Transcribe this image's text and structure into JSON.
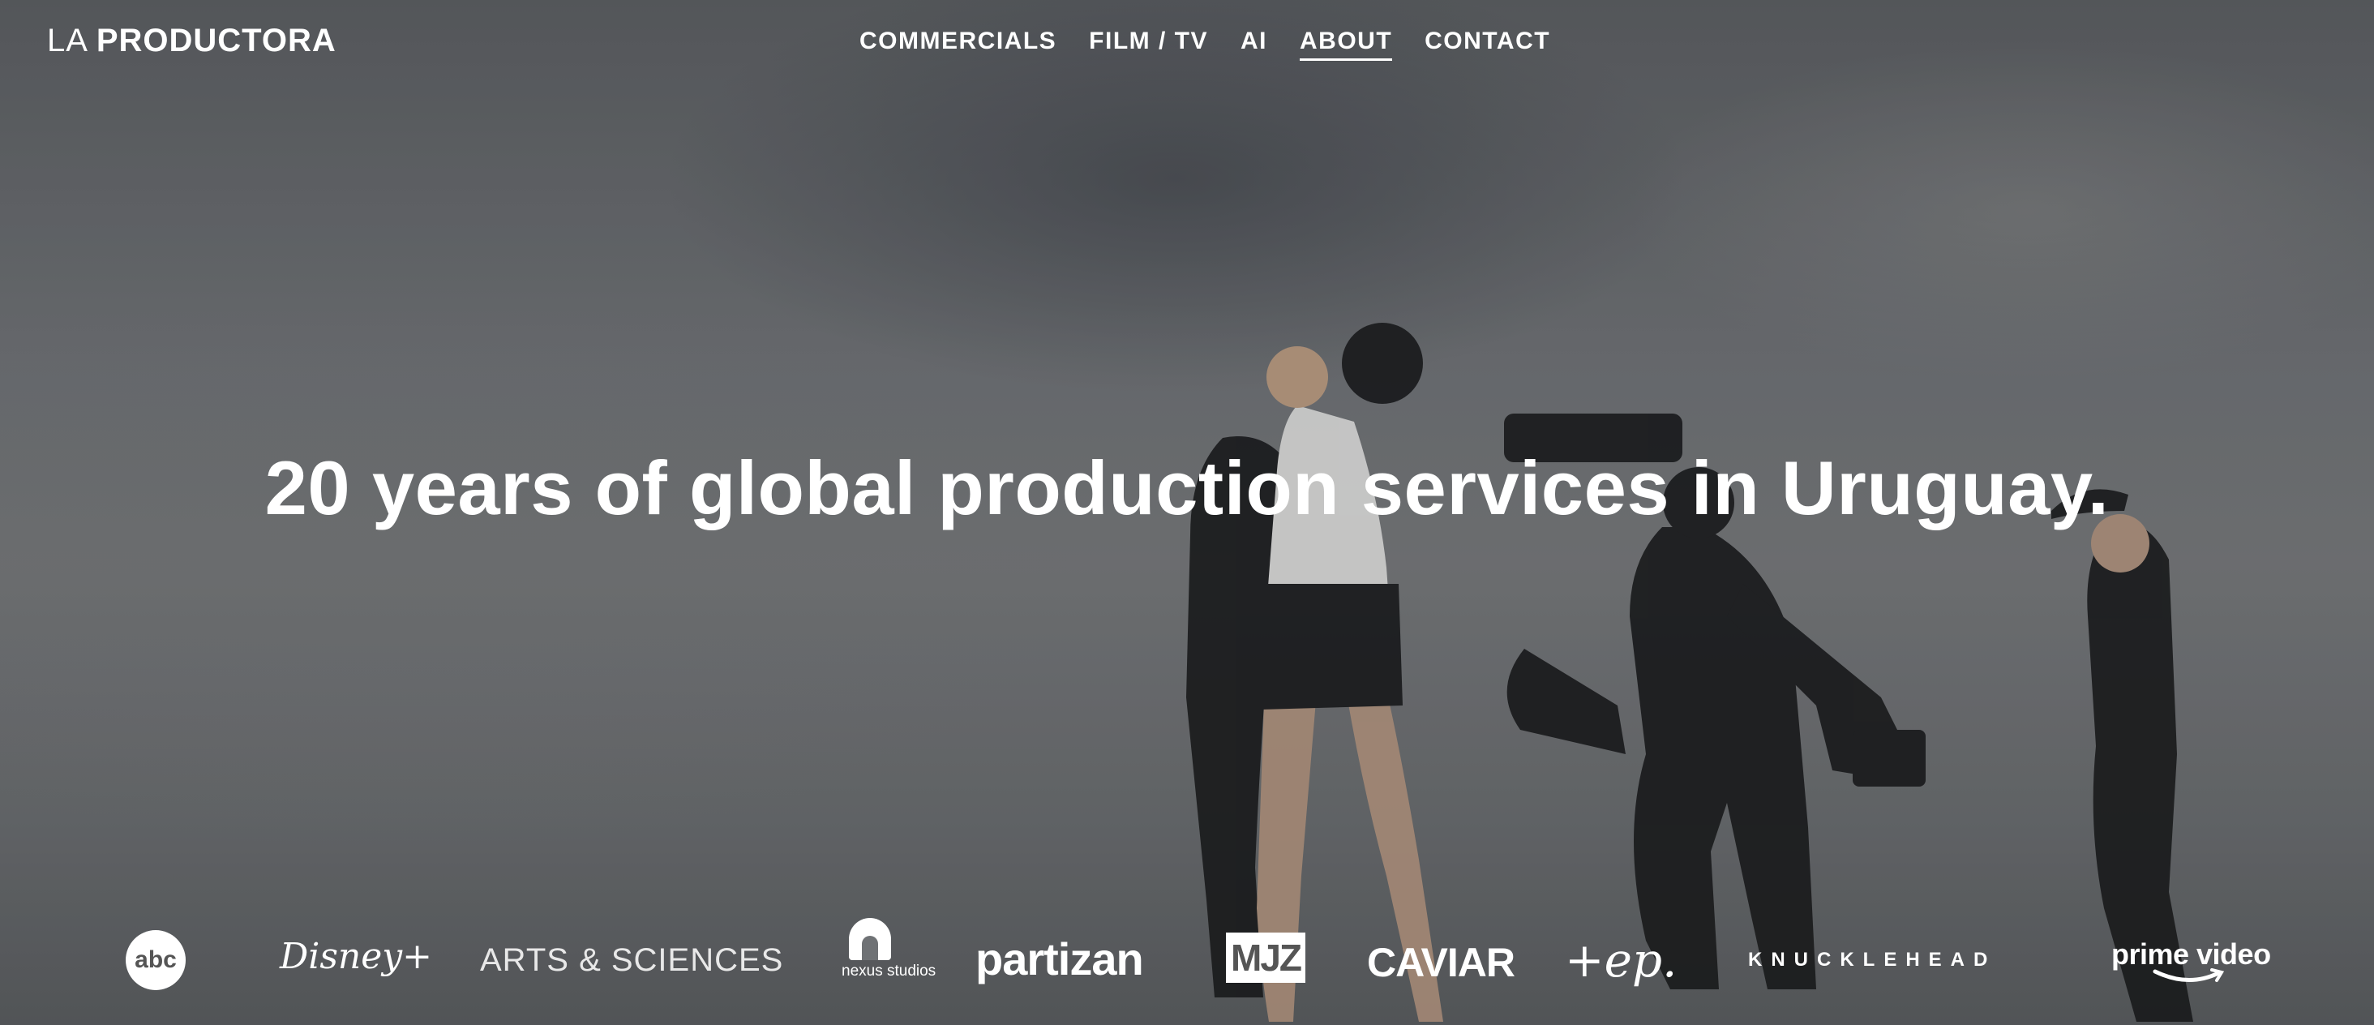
{
  "header": {
    "logo_light": "LA ",
    "logo_bold": "PRODUCTORA"
  },
  "nav": {
    "items": [
      {
        "label": "COMMERCIALS",
        "active": false
      },
      {
        "label": "FILM / TV",
        "active": false
      },
      {
        "label": "AI",
        "active": false
      },
      {
        "label": "ABOUT",
        "active": true
      },
      {
        "label": "CONTACT",
        "active": false
      }
    ]
  },
  "hero": {
    "headline": "20 years of global production services in Uruguay."
  },
  "clients": {
    "abc": "abc",
    "disney": "Disney+",
    "arts": "ARTS & SCIENCES",
    "nexus": "nexus studios",
    "partizan": "partizan",
    "mjz": "MJZ",
    "caviar": "CAVIAR",
    "ep": "+ep.",
    "knucklehead": "KNUCKLEHEAD",
    "prime": "prime video"
  },
  "colors": {
    "text": "#ffffff",
    "overlay": "#6f7275"
  }
}
